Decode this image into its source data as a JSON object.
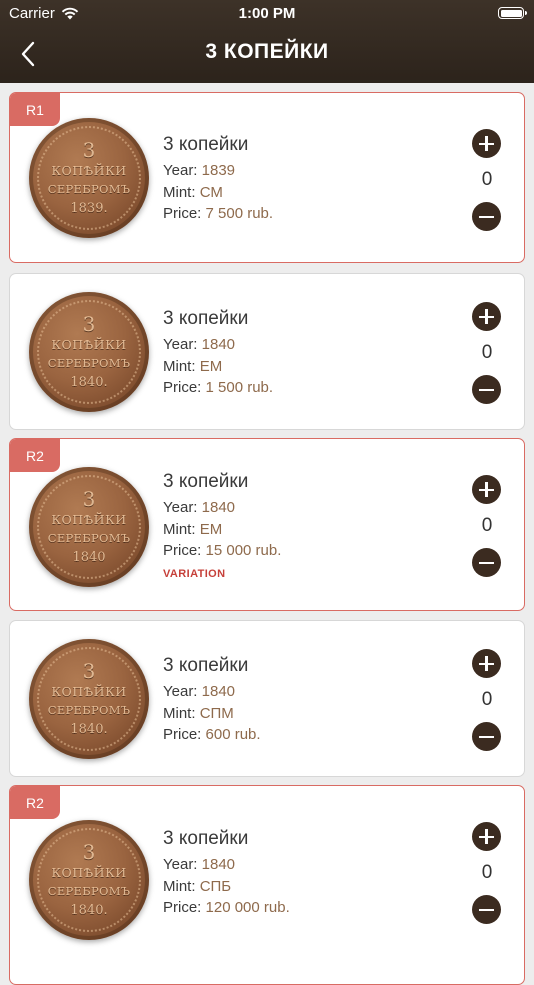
{
  "status_bar": {
    "carrier": "Carrier",
    "time": "1:00 PM"
  },
  "header": {
    "title": "3 КОПЕЙКИ",
    "back_icon": "chevron-left-icon"
  },
  "coins": [
    {
      "badge": "R1",
      "name": "3 копейки",
      "year_label": "Year:",
      "year": "1839",
      "mint_label": "Mint:",
      "mint": "СМ",
      "price_label": "Price:",
      "price": "7 500 rub.",
      "variation": "",
      "count": "0",
      "coin_lines": [
        "3",
        "КОПѢЙКИ",
        "СЕРЕБРОМЪ",
        "1839."
      ]
    },
    {
      "badge": "",
      "name": "3 копейки",
      "year_label": "Year:",
      "year": "1840",
      "mint_label": "Mint:",
      "mint": "ЕМ",
      "price_label": "Price:",
      "price": "1 500 rub.",
      "variation": "",
      "count": "0",
      "coin_lines": [
        "3",
        "КОПѢЙКИ",
        "СЕРЕБРОМЪ",
        "1840."
      ]
    },
    {
      "badge": "R2",
      "name": "3 копейки",
      "year_label": "Year:",
      "year": "1840",
      "mint_label": "Mint:",
      "mint": "ЕМ",
      "price_label": "Price:",
      "price": "15 000 rub.",
      "variation": "VARIATION",
      "count": "0",
      "coin_lines": [
        "3",
        "КОПѢЙКИ",
        "СЕРЕБРОМЪ",
        "1840"
      ]
    },
    {
      "badge": "",
      "name": "3 копейки",
      "year_label": "Year:",
      "year": "1840",
      "mint_label": "Mint:",
      "mint": "СПМ",
      "price_label": "Price:",
      "price": "600 rub.",
      "variation": "",
      "count": "0",
      "coin_lines": [
        "3",
        "КОПѢЙКИ",
        "СЕРЕБРОМЪ",
        "1840."
      ]
    },
    {
      "badge": "R2",
      "name": "3 копейки",
      "year_label": "Year:",
      "year": "1840",
      "mint_label": "Mint:",
      "mint": "СПБ",
      "price_label": "Price:",
      "price": "120 000 rub.",
      "variation": "",
      "count": "0",
      "coin_lines": [
        "3",
        "КОПѢЙКИ",
        "СЕРЕБРОМЪ",
        "1840."
      ]
    }
  ],
  "colors": {
    "header_bg": "#2c231b",
    "badge": "#d96b63",
    "value_text": "#8e6a4c",
    "button": "#3b2b20",
    "variation": "#c6403a"
  }
}
